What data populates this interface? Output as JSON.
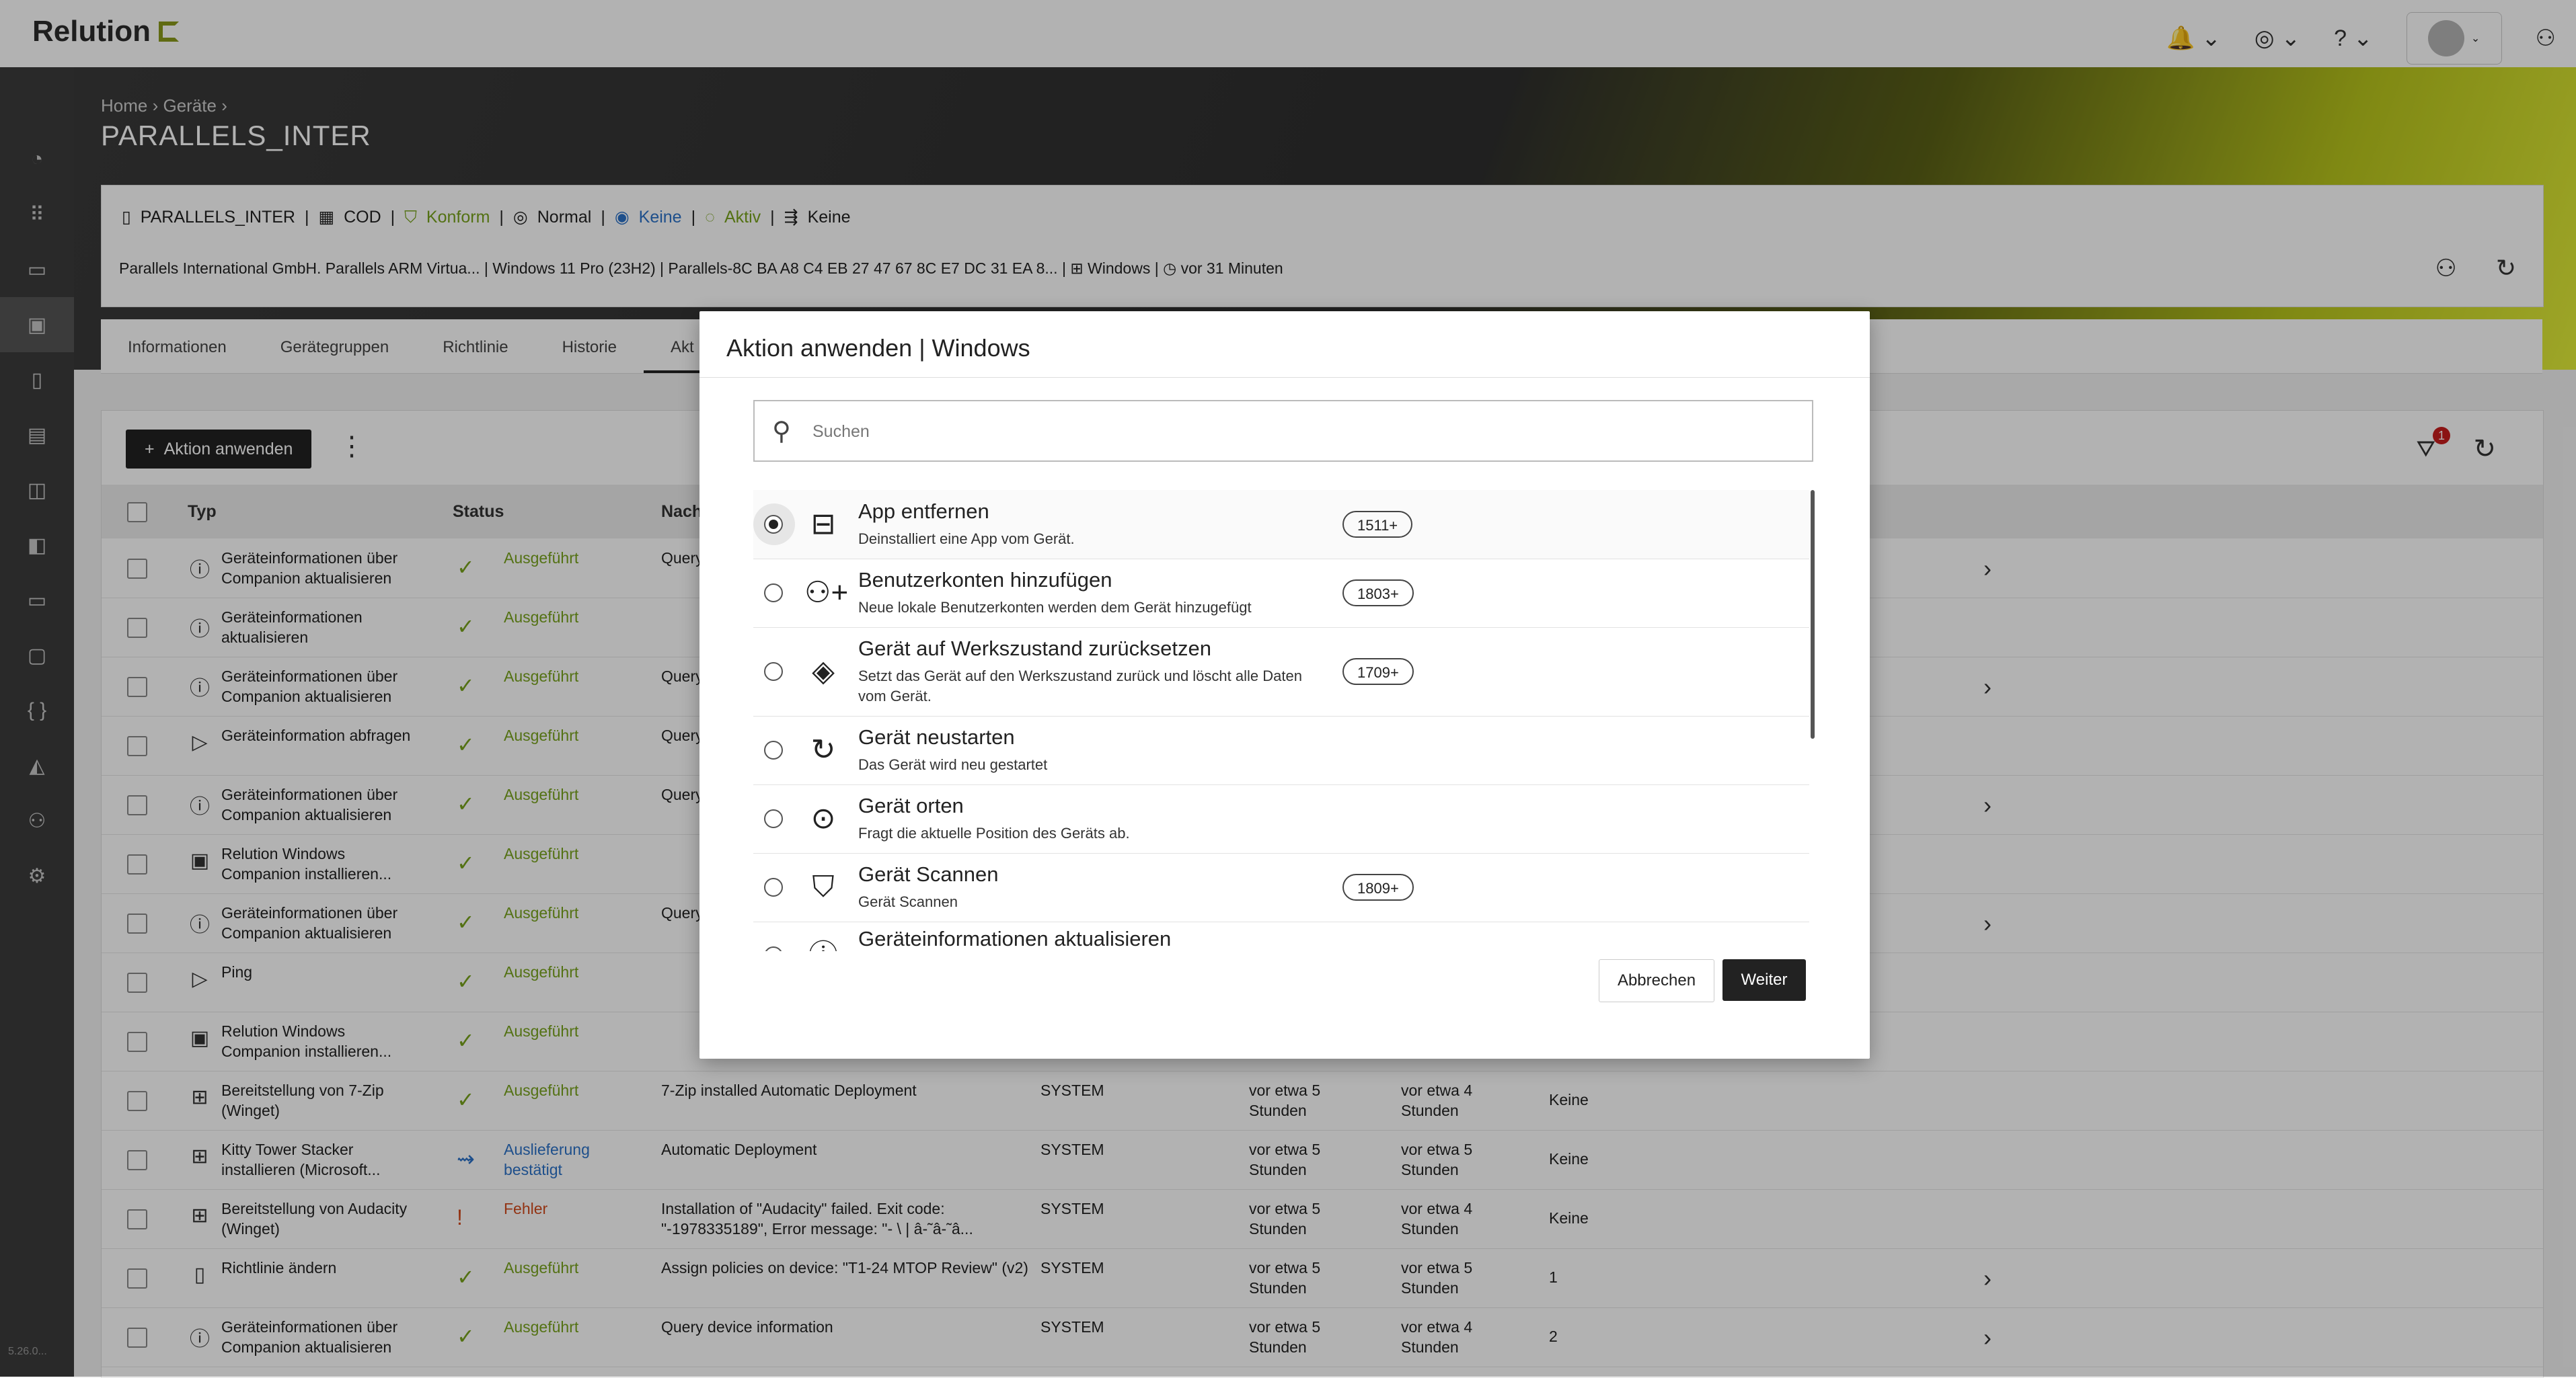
{
  "brand": {
    "name": "Relution",
    "accent": "#8a9a1c"
  },
  "version": "5.26.0...",
  "breadcrumb": {
    "home": "Home",
    "devices": "Geräte"
  },
  "page_title": "PARALLELS_INTER",
  "device": {
    "name": "PARALLELS_INTER",
    "ownership": "COD",
    "compliance": "Konform",
    "mode": "Normal",
    "lock": "Keine",
    "status": "Aktiv",
    "policy": "Keine",
    "details": "Parallels International GmbH. Parallels ARM Virtua... | Windows 11 Pro (23H2) | Parallels-8C BA A8 C4 EB 27 47 67 8C E7 DC 31 EA 8... |",
    "platform": "Windows",
    "last_seen": "vor 31 Minuten"
  },
  "tabs": [
    "Informationen",
    "Gerätegruppen",
    "Richtlinie",
    "Historie",
    "Akt"
  ],
  "toolbar": {
    "apply_action": "Aktion anwenden",
    "filter_badge": "1"
  },
  "table": {
    "headers": {
      "type": "Typ",
      "status": "Status",
      "message": "Nach"
    },
    "rows": [
      {
        "type": "Geräteinformationen über Companion aktualisieren",
        "status": "Ausgeführt",
        "message": "Query",
        "chevron": true
      },
      {
        "type": "Geräteinformationen aktualisieren",
        "status": "Ausgeführt",
        "message": "",
        "chevron": false
      },
      {
        "type": "Geräteinformationen über Companion aktualisieren",
        "status": "Ausgeführt",
        "message": "Query",
        "chevron": true
      },
      {
        "type": "Geräteinformation abfragen",
        "status": "Ausgeführt",
        "message": "Query",
        "chevron": false
      },
      {
        "type": "Geräteinformationen über Companion aktualisieren",
        "status": "Ausgeführt",
        "message": "Query",
        "chevron": true
      },
      {
        "type": "Relution Windows Companion installieren...",
        "status": "Ausgeführt",
        "message": "",
        "chevron": false
      },
      {
        "type": "Geräteinformationen über Companion aktualisieren",
        "status": "Ausgeführt",
        "message": "Query",
        "chevron": true
      },
      {
        "type": "Ping",
        "status": "Ausgeführt",
        "message": "",
        "chevron": false
      },
      {
        "type": "Relution Windows Companion installieren...",
        "status": "Ausgeführt",
        "message": "",
        "chevron": false
      },
      {
        "type": "Bereitstellung von 7-Zip (Winget)",
        "status": "Ausgeführt",
        "message": "7-Zip installed Automatic Deployment",
        "user": "SYSTEM",
        "created": "vor etwa 5 Stunden",
        "updated": "vor etwa 4 Stunden",
        "extra": "Keine",
        "chevron": false
      },
      {
        "type": "Kitty Tower Stacker installieren (Microsoft...",
        "status": "Auslieferung bestätigt",
        "message": "Automatic Deployment",
        "user": "SYSTEM",
        "created": "vor etwa 5 Stunden",
        "updated": "vor etwa 5 Stunden",
        "extra": "Keine",
        "chevron": false
      },
      {
        "type": "Bereitstellung von Audacity (Winget)",
        "status": "Fehler",
        "message": "Installation of \"Audacity\" failed. Exit code: \"-1978335189\", Error message: \"- \\ |  â-˜â-˜â...",
        "user": "SYSTEM",
        "created": "vor etwa 5 Stunden",
        "updated": "vor etwa 4 Stunden",
        "extra": "Keine",
        "chevron": false
      },
      {
        "type": "Richtlinie ändern",
        "status": "Ausgeführt",
        "message": "Assign policies on device: \"T1-24 MTOP Review\" (v2)",
        "user": "SYSTEM",
        "created": "vor etwa 5 Stunden",
        "updated": "vor etwa 5 Stunden",
        "extra": "1",
        "chevron": true
      },
      {
        "type": "Geräteinformationen über Companion aktualisieren",
        "status": "Ausgeführt",
        "message": "Query device information",
        "user": "SYSTEM",
        "created": "vor etwa 5 Stunden",
        "updated": "vor etwa 4 Stunden",
        "extra": "2",
        "chevron": true
      }
    ]
  },
  "modal": {
    "title": "Aktion anwenden | Windows",
    "search_placeholder": "Suchen",
    "items": [
      {
        "title": "App entfernen",
        "desc": "Deinstalliert eine App vom Gerät.",
        "pill": "1511+",
        "icon": "app-remove-icon",
        "selected": true
      },
      {
        "title": "Benutzerkonten hinzufügen",
        "desc": "Neue lokale Benutzerkonten werden dem Gerät hinzugefügt",
        "pill": "1803+",
        "icon": "add-user-icon",
        "selected": false
      },
      {
        "title": "Gerät auf Werkszustand zurücksetzen",
        "desc": "Setzt das Gerät auf den Werkszustand zurück und löscht alle Daten vom Gerät.",
        "pill": "1709+",
        "icon": "eraser-icon",
        "selected": false
      },
      {
        "title": "Gerät neustarten",
        "desc": "Das Gerät wird neu gestartet",
        "pill": "",
        "icon": "restart-icon",
        "selected": false
      },
      {
        "title": "Gerät orten",
        "desc": "Fragt die aktuelle Position des Geräts ab.",
        "pill": "",
        "icon": "locate-icon",
        "selected": false
      },
      {
        "title": "Gerät Scannen",
        "desc": "Gerät Scannen",
        "pill": "1809+",
        "icon": "shield-icon",
        "selected": false
      },
      {
        "title": "Geräteinformationen aktualisieren",
        "desc": "",
        "pill": "",
        "icon": "refresh-info-icon",
        "selected": false
      }
    ],
    "cancel": "Abbrechen",
    "next": "Weiter"
  }
}
